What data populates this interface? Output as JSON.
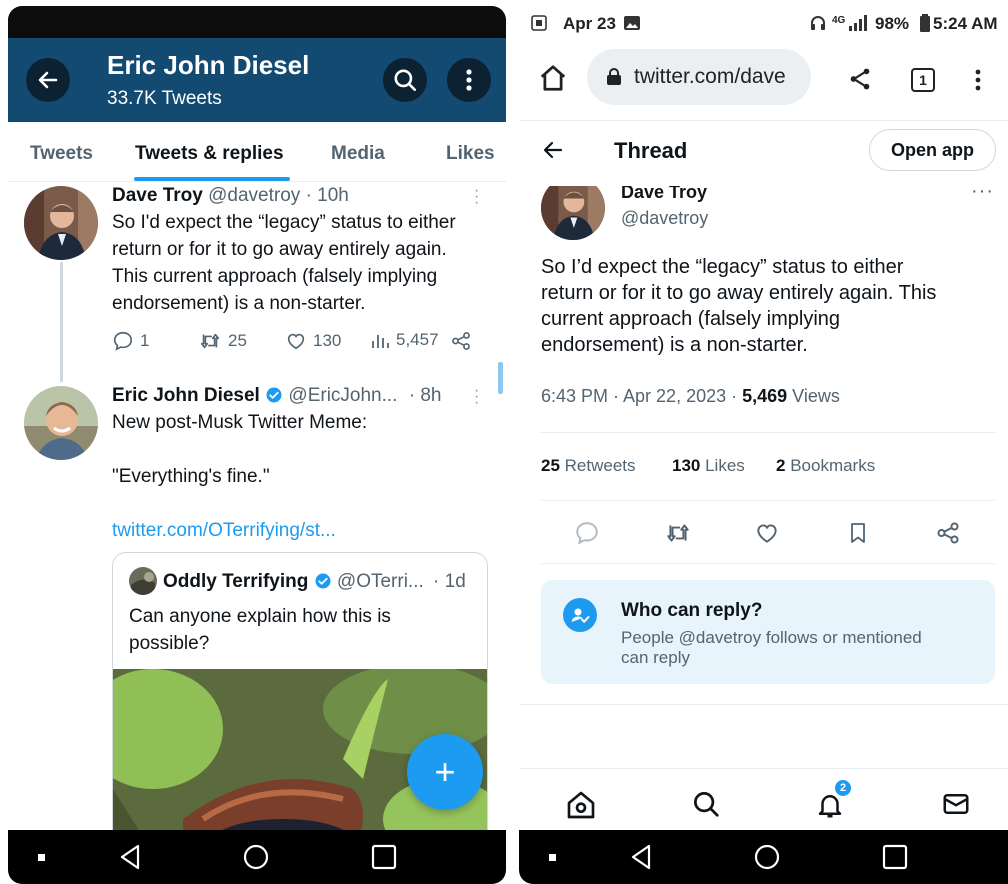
{
  "left": {
    "header": {
      "title": "Eric John Diesel",
      "subtitle": "33.7K Tweets"
    },
    "tabs": [
      {
        "label": "Tweets"
      },
      {
        "label": "Tweets & replies"
      },
      {
        "label": "Media"
      },
      {
        "label": "Likes"
      }
    ],
    "tweet1": {
      "name": "Dave Troy",
      "handle": "@davetroy",
      "time": "· 10h",
      "lines": [
        "So I'd expect the “legacy” status to either",
        "return or for it to go away entirely again.",
        "This current approach (falsely implying",
        "endorsement) is a non-starter."
      ],
      "replies": "1",
      "retweets": "25",
      "likes": "130",
      "views": "5,457"
    },
    "tweet2": {
      "name": "Eric John Diesel",
      "handle": "@EricJohn...",
      "time": "· 8h",
      "line1": "New post-Musk Twitter Meme:",
      "line2": "\"Everything's fine.\"",
      "link": "twitter.com/OTerrifying/st..."
    },
    "quote": {
      "name": "Oddly Terrifying",
      "handle": "@OTerri...",
      "time": "· 1d",
      "line1": "Can anyone explain how this is",
      "line2": "possible?"
    },
    "fab_label": "+"
  },
  "right": {
    "status": {
      "date": "Apr 23",
      "battery": "98%",
      "time": "5:24 AM",
      "network": "4G"
    },
    "browser": {
      "url": "twitter.com/dave",
      "tab_count": "1"
    },
    "thread": {
      "title": "Thread",
      "open_app": "Open app"
    },
    "tweet": {
      "name": "Dave Troy",
      "handle": "@davetroy",
      "lines": [
        "So I’d expect the “legacy” status to either",
        "return or for it to go away entirely again. This",
        "current approach (falsely implying",
        "endorsement) is a non-starter."
      ],
      "timestamp": "6:43 PM · Apr 22, 2023 · ",
      "views_count": "5,469",
      "views_label": " Views"
    },
    "stats": {
      "retweets_count": "25",
      "retweets_label": " Retweets",
      "likes_count": "130",
      "likes_label": " Likes",
      "bookmarks_count": "2",
      "bookmarks_label": " Bookmarks"
    },
    "who_can_reply": {
      "title": "Who can reply?",
      "line1": "People @davetroy follows or mentioned",
      "line2": "can reply"
    },
    "notifications_badge": "2"
  },
  "colors": {
    "header_blue": "#134a72",
    "twitter_blue": "#1d9bf0",
    "muted_text": "#536471",
    "reply_box_bg": "#e8f4fb"
  }
}
